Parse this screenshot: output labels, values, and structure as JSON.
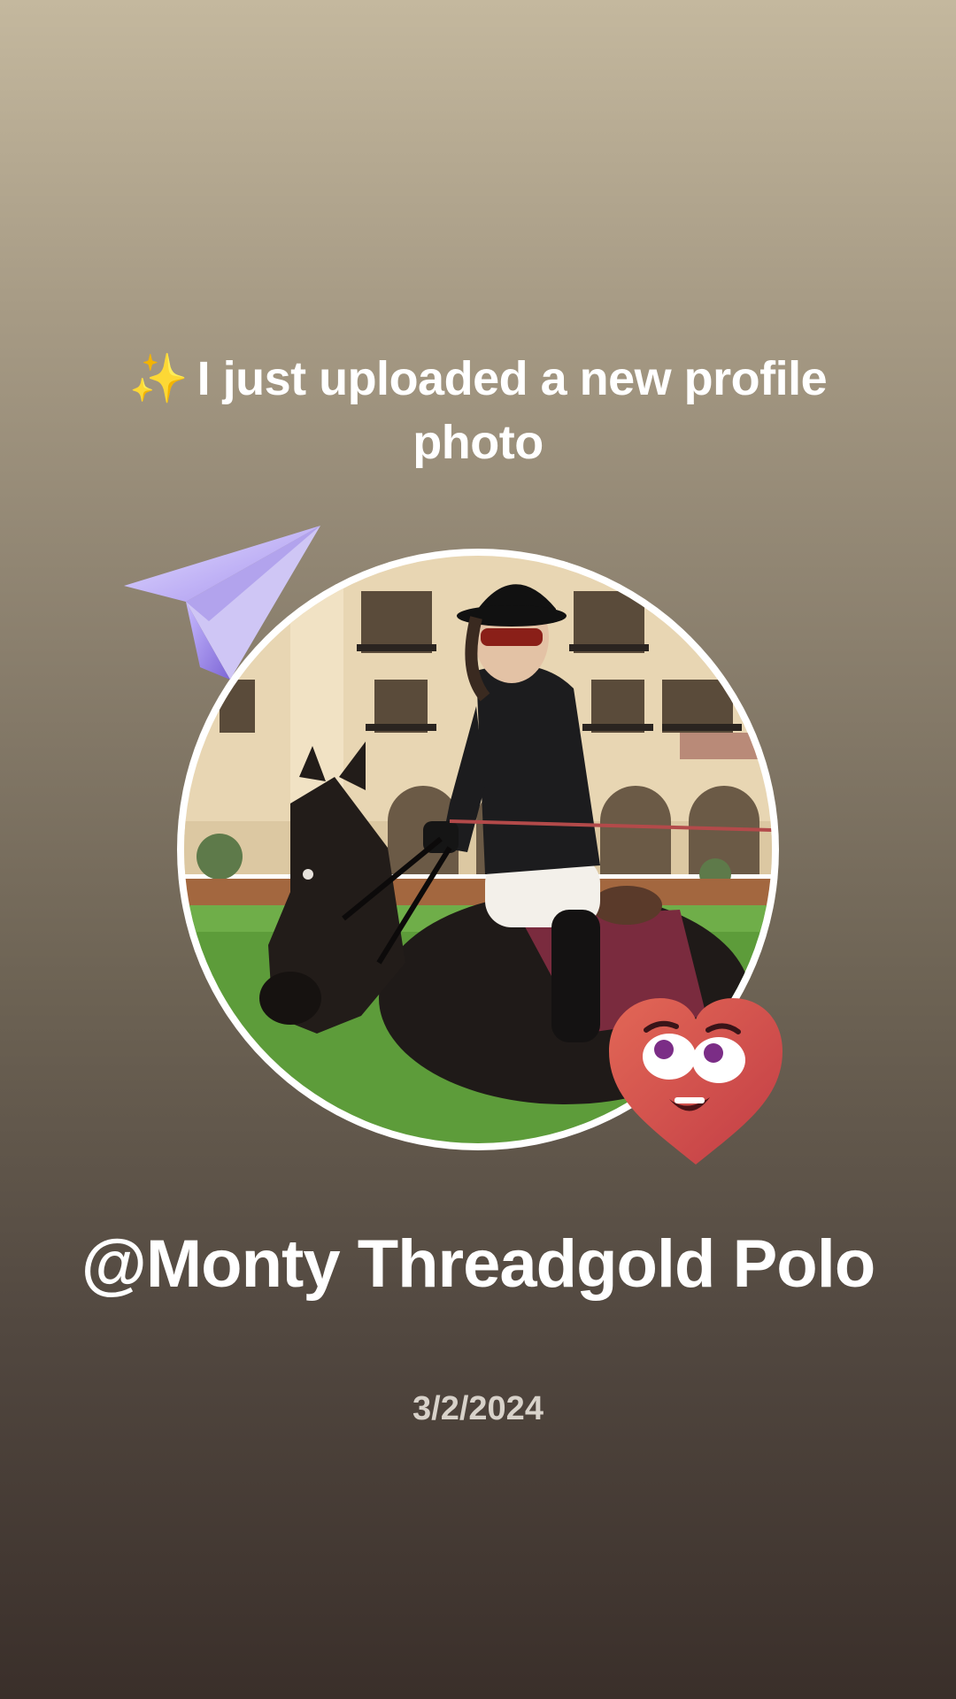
{
  "story": {
    "headline_emoji": "✨",
    "headline": "I just uploaded a new profile photo",
    "username": "@Monty Threadgold Polo",
    "date": "3/2/2024"
  },
  "stickers": {
    "plane": "paper-plane-icon",
    "heart": "heart-face-icon"
  },
  "colors": {
    "background_top": "#c4b89e",
    "background_bottom": "#3a2f2a",
    "text": "#ffffff",
    "date_text": "#d8d2ca",
    "plane": "#b6a6f0",
    "heart": "#d9544f"
  }
}
